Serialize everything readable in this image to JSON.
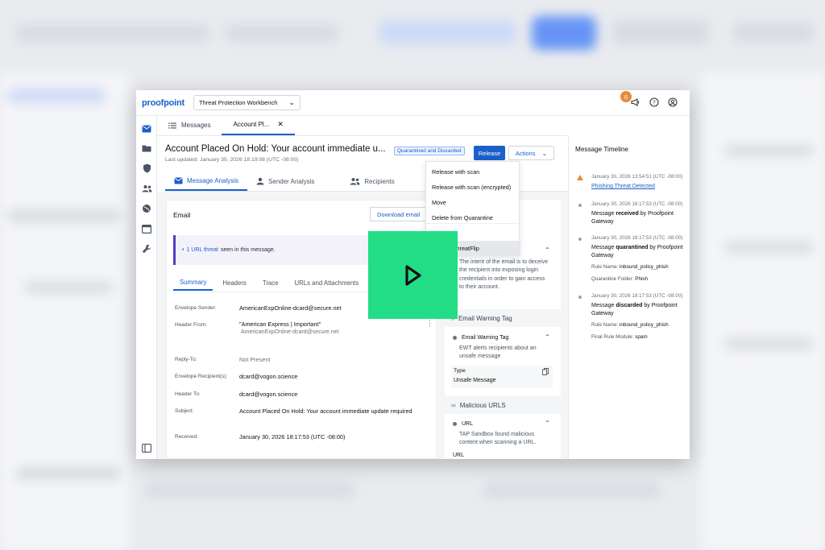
{
  "topbar": {
    "logo": "proofpoint",
    "workspace": "Threat Protection Workbench",
    "notification_count": "6"
  },
  "page_tabs": [
    {
      "label": "Messages"
    },
    {
      "label": "Account Pl..."
    }
  ],
  "message": {
    "title": "Account Placed On Hold: Your account immediate u...",
    "status": "Quarantined and Discarded",
    "last_updated": "Last updated: January 30, 2026 18:19:08 (UTC -08:00)",
    "release_label": "Release",
    "actions_label": "Actions"
  },
  "analysis_tabs": [
    "Message Analysis",
    "Sender Analysis",
    "Recipients"
  ],
  "email": {
    "label": "Email",
    "download_label": "Download email",
    "threat_count": "1 URL threat",
    "threat_suffix": "seen in this message.",
    "subtabs": [
      "Summary",
      "Headers",
      "Trace",
      "URLs and Attachments"
    ],
    "fields": [
      {
        "label": "Envelope Sender:",
        "value": "AmericanExpOnline-dcard@secure.net"
      },
      {
        "label": "Header From:",
        "value": "\"American Express | Important\"",
        "sub": "AmericanExpOnline-dcard@secure.net"
      },
      {
        "label": "Reply-To:",
        "value": "Not Present"
      },
      {
        "label": "Envelope Recipient(s):",
        "value": "dcard@vogon.science"
      },
      {
        "label": "Header To:",
        "value": "dcard@vogon.science"
      },
      {
        "label": "Subject:",
        "value": "Account Placed On Hold: Your account immediate update required"
      },
      {
        "label": "Received:",
        "value": "January 30, 2026 18:17:53 (UTC -08:00)"
      }
    ]
  },
  "threat_panel": {
    "threatflip_text": "The intent of the email is to deceive the recipient into exposing login credentials in order to gain access to their account.",
    "ewt_section": "Email Warning Tag",
    "ewt_title": "Email Warning Tag",
    "ewt_text": "EWT alerts recipients about an unsafe message",
    "type_label": "Type",
    "type_value": "Unsafe Message",
    "urls_section": "Malicious URLS",
    "url_title": "URL",
    "url_text": "TAP Sandbox found malicious content when scanning a URL.",
    "url_label": "URL"
  },
  "actions_menu": {
    "items": [
      "Release with scan",
      "Release with scan (encrypted)",
      "Move",
      "Delete from Quarantine"
    ],
    "highlighted": "ThreatFlip"
  },
  "timeline": {
    "header": "Message Timeline",
    "events": [
      {
        "time": "January 30, 2026 13:54:51 (UTC -08:00)",
        "text": "Phishing Threat Detected"
      },
      {
        "time": "January 30, 2026 18:17:53 (UTC -08:00)",
        "pre": "Message",
        "bold": "received",
        "post": "by Proofpoint Gateway"
      },
      {
        "time": "January 30, 2026 18:17:53 (UTC -08:00)",
        "pre": "Message",
        "bold": "quarantined",
        "post": "by Proofpoint Gateway",
        "meta": [
          {
            "label": "Rule Name:",
            "value": "inbound_policy_phish"
          },
          {
            "label": "Quarantine Folder:",
            "value": "Phish"
          }
        ]
      },
      {
        "time": "January 30, 2026 18:17:53 (UTC -08:00)",
        "pre": "Message",
        "bold": "discarded",
        "post": "by Proofpoint Gateway",
        "meta": [
          {
            "label": "Rule Name:",
            "value": "inbound_policy_phish"
          },
          {
            "label": "Final Rule Module:",
            "value": "spam"
          }
        ]
      }
    ]
  },
  "colors": {
    "brand": "#1b5fcc",
    "play_overlay": "#22dd85",
    "warning": "#e98a3d"
  }
}
